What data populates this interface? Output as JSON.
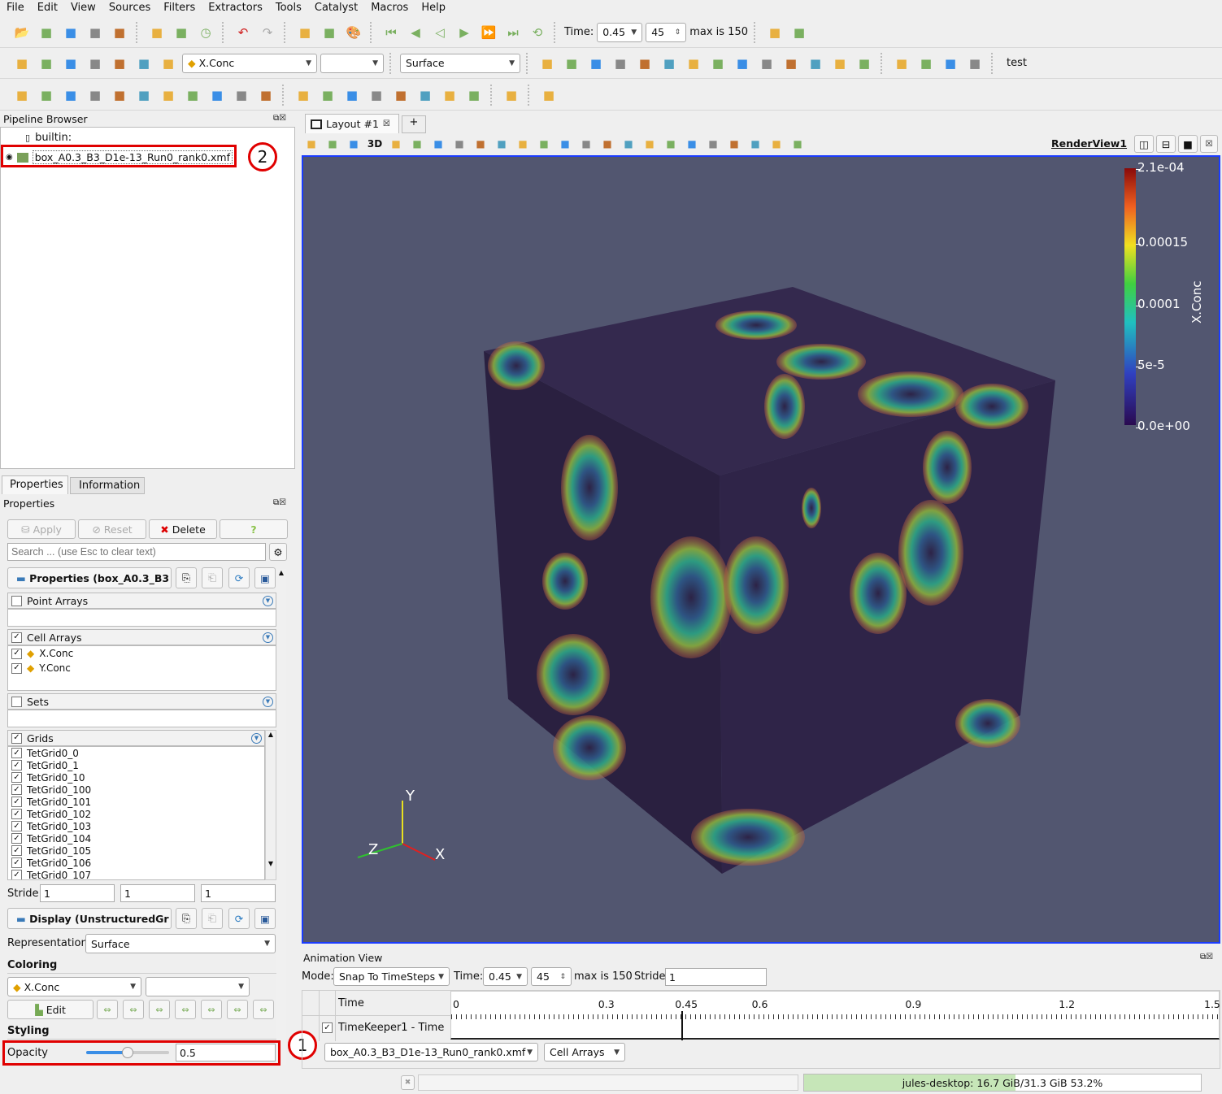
{
  "menu": [
    "File",
    "Edit",
    "View",
    "Sources",
    "Filters",
    "Extractors",
    "Tools",
    "Catalyst",
    "Macros",
    "Help"
  ],
  "toolbar1": {
    "icons": [
      "open-icon",
      "load-state-icon",
      "save-data-icon",
      "reset-session-icon",
      "python-shell-icon",
      "connect-icon",
      "disconnect-icon",
      "timer-icon",
      "undo-icon",
      "redo-icon",
      "camera-link-icon",
      "save-screenshot-icon",
      "palette-icon",
      "first-frame-icon",
      "previous-frame-icon",
      "play-reverse-icon",
      "play-icon",
      "next-frame-icon",
      "last-frame-icon",
      "loop-icon"
    ],
    "time_label": "Time:",
    "time_value": "0.45",
    "step_value": "45",
    "max_label": "max is 150",
    "zoom_icons": [
      "zoom-data-icon",
      "zoom-closest-icon"
    ]
  },
  "toolbar2": {
    "color_array": "X.Conc",
    "component": "",
    "representation": "Surface",
    "right_label": "test"
  },
  "toolbar3": {},
  "pipeline": {
    "title": "Pipeline Browser",
    "root": "builtin:",
    "item": "box_A0.3_B3_D1e-13_Run0_rank0.xmf"
  },
  "tabs": {
    "properties": "Properties",
    "information": "Information"
  },
  "properties": {
    "title": "Properties",
    "apply": "Apply",
    "reset": "Reset",
    "delete": "Delete",
    "help": "?",
    "search_placeholder": "Search ... (use Esc to clear text)",
    "section_props": "Properties (box_A0.3_B3",
    "point_arrays": "Point Arrays",
    "cell_arrays": "Cell Arrays",
    "cells": [
      "X.Conc",
      "Y.Conc"
    ],
    "sets": "Sets",
    "grids": "Grids",
    "grid_items": [
      "TetGrid0_0",
      "TetGrid0_1",
      "TetGrid0_10",
      "TetGrid0_100",
      "TetGrid0_101",
      "TetGrid0_102",
      "TetGrid0_103",
      "TetGrid0_104",
      "TetGrid0_105",
      "TetGrid0_106",
      "TetGrid0_107"
    ],
    "stride_label": "Stride",
    "stride": [
      "1",
      "1",
      "1"
    ],
    "section_display": "Display (UnstructuredGr",
    "representation_label": "Representation",
    "representation": "Surface",
    "coloring_label": "Coloring",
    "coloring_array": "X.Conc",
    "edit": "Edit",
    "styling_label": "Styling",
    "opacity_label": "Opacity",
    "opacity": "0.5",
    "opacity_fraction": 0.5
  },
  "layout": {
    "tab": "Layout #1",
    "add": "+",
    "view_name": "RenderView1",
    "btn_3d": "3D"
  },
  "colorbar": {
    "title": "X.Conc",
    "labels": [
      "2.1e-04",
      "0.00015",
      "0.0001",
      "5e-5",
      "0.0e+00"
    ]
  },
  "axes": {
    "x": "X",
    "y": "Y",
    "z": "Z"
  },
  "animation": {
    "title": "Animation View",
    "mode_label": "Mode:",
    "mode": "Snap To TimeSteps",
    "time_label": "Time:",
    "time": "0.45",
    "step": "45",
    "max": "max is 150",
    "stride_label": "Stride",
    "stride": "1",
    "col_time": "Time",
    "ticks": [
      "0",
      "0.3",
      "0.45",
      "0.6",
      "0.9",
      "1.2",
      "1.5"
    ],
    "track": "TimeKeeper1 - Time",
    "source": "box_A0.3_B3_D1e-13_Run0_rank0.xmf",
    "arrays": "Cell Arrays",
    "current_fraction": 0.3
  },
  "status": {
    "memory": "jules-desktop: 16.7 GiB/31.3 GiB 53.2%",
    "memory_fraction": 0.532
  },
  "annotations": [
    "1",
    "2"
  ],
  "colors": {
    "view_bg": "#525670",
    "cube": "#2d2346",
    "highlight": "#e00000",
    "accent": "#3a7ab8"
  }
}
